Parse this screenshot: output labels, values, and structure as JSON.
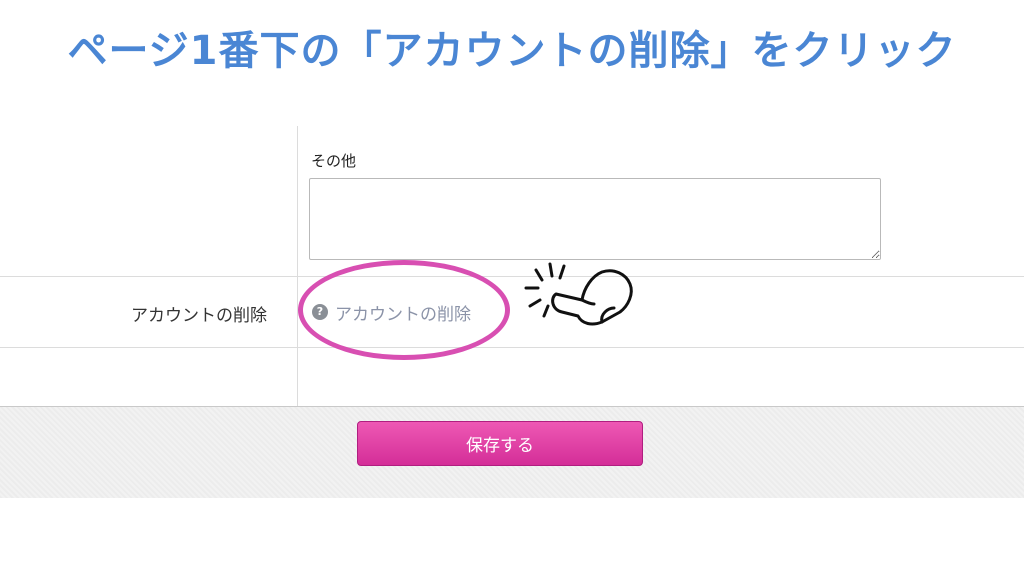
{
  "headline": "ページ1番下の「アカウントの削除」をクリック",
  "form": {
    "other_label": "その他",
    "other_value": "",
    "delete_row_label": "アカウントの削除",
    "help_icon": "question-circle-icon",
    "help_glyph": "?",
    "delete_link": "アカウントの削除",
    "save_button": "保存する"
  },
  "annotation": {
    "highlight_color": "#d84fb2",
    "pointer_icon": "pointing-hand-icon"
  },
  "colors": {
    "headline": "#4a86d4",
    "button": "#dd3ea2",
    "link": "#8b93a8"
  }
}
